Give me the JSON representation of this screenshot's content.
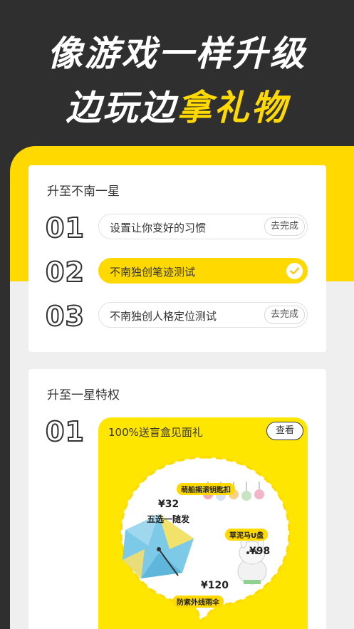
{
  "hero": {
    "line1": "像游戏一样升级",
    "line2_white": "边玩边",
    "line2_yellow": "拿礼物"
  },
  "level_card": {
    "title": "升至不南一星",
    "tasks": [
      {
        "number": "01",
        "label": "设置让你变好的习惯",
        "action": "去完成",
        "done": false
      },
      {
        "number": "02",
        "label": "不南独创笔迹测试",
        "action": "",
        "done": true
      },
      {
        "number": "03",
        "label": "不南独创人格定位测试",
        "action": "去完成",
        "done": false
      }
    ]
  },
  "perk_card": {
    "title": "升至一星特权",
    "perks": [
      {
        "number": "01",
        "label": "100%送盲盒见面礼",
        "action": "查看",
        "promo": {
          "keychain_pill": "萌船摇滚钥匙扣",
          "keychain_price": "¥32",
          "pick_text": "五选一随发",
          "usb_pill": "草泥马U盘",
          "usb_price": "¥98",
          "umbrella_price": "¥120",
          "umbrella_pill": "防紫外线雨伞"
        }
      }
    ]
  },
  "colors": {
    "brand_yellow": "#ffd900",
    "dark_bg": "#2f2f2f"
  },
  "icons": {
    "check": "check-icon"
  }
}
